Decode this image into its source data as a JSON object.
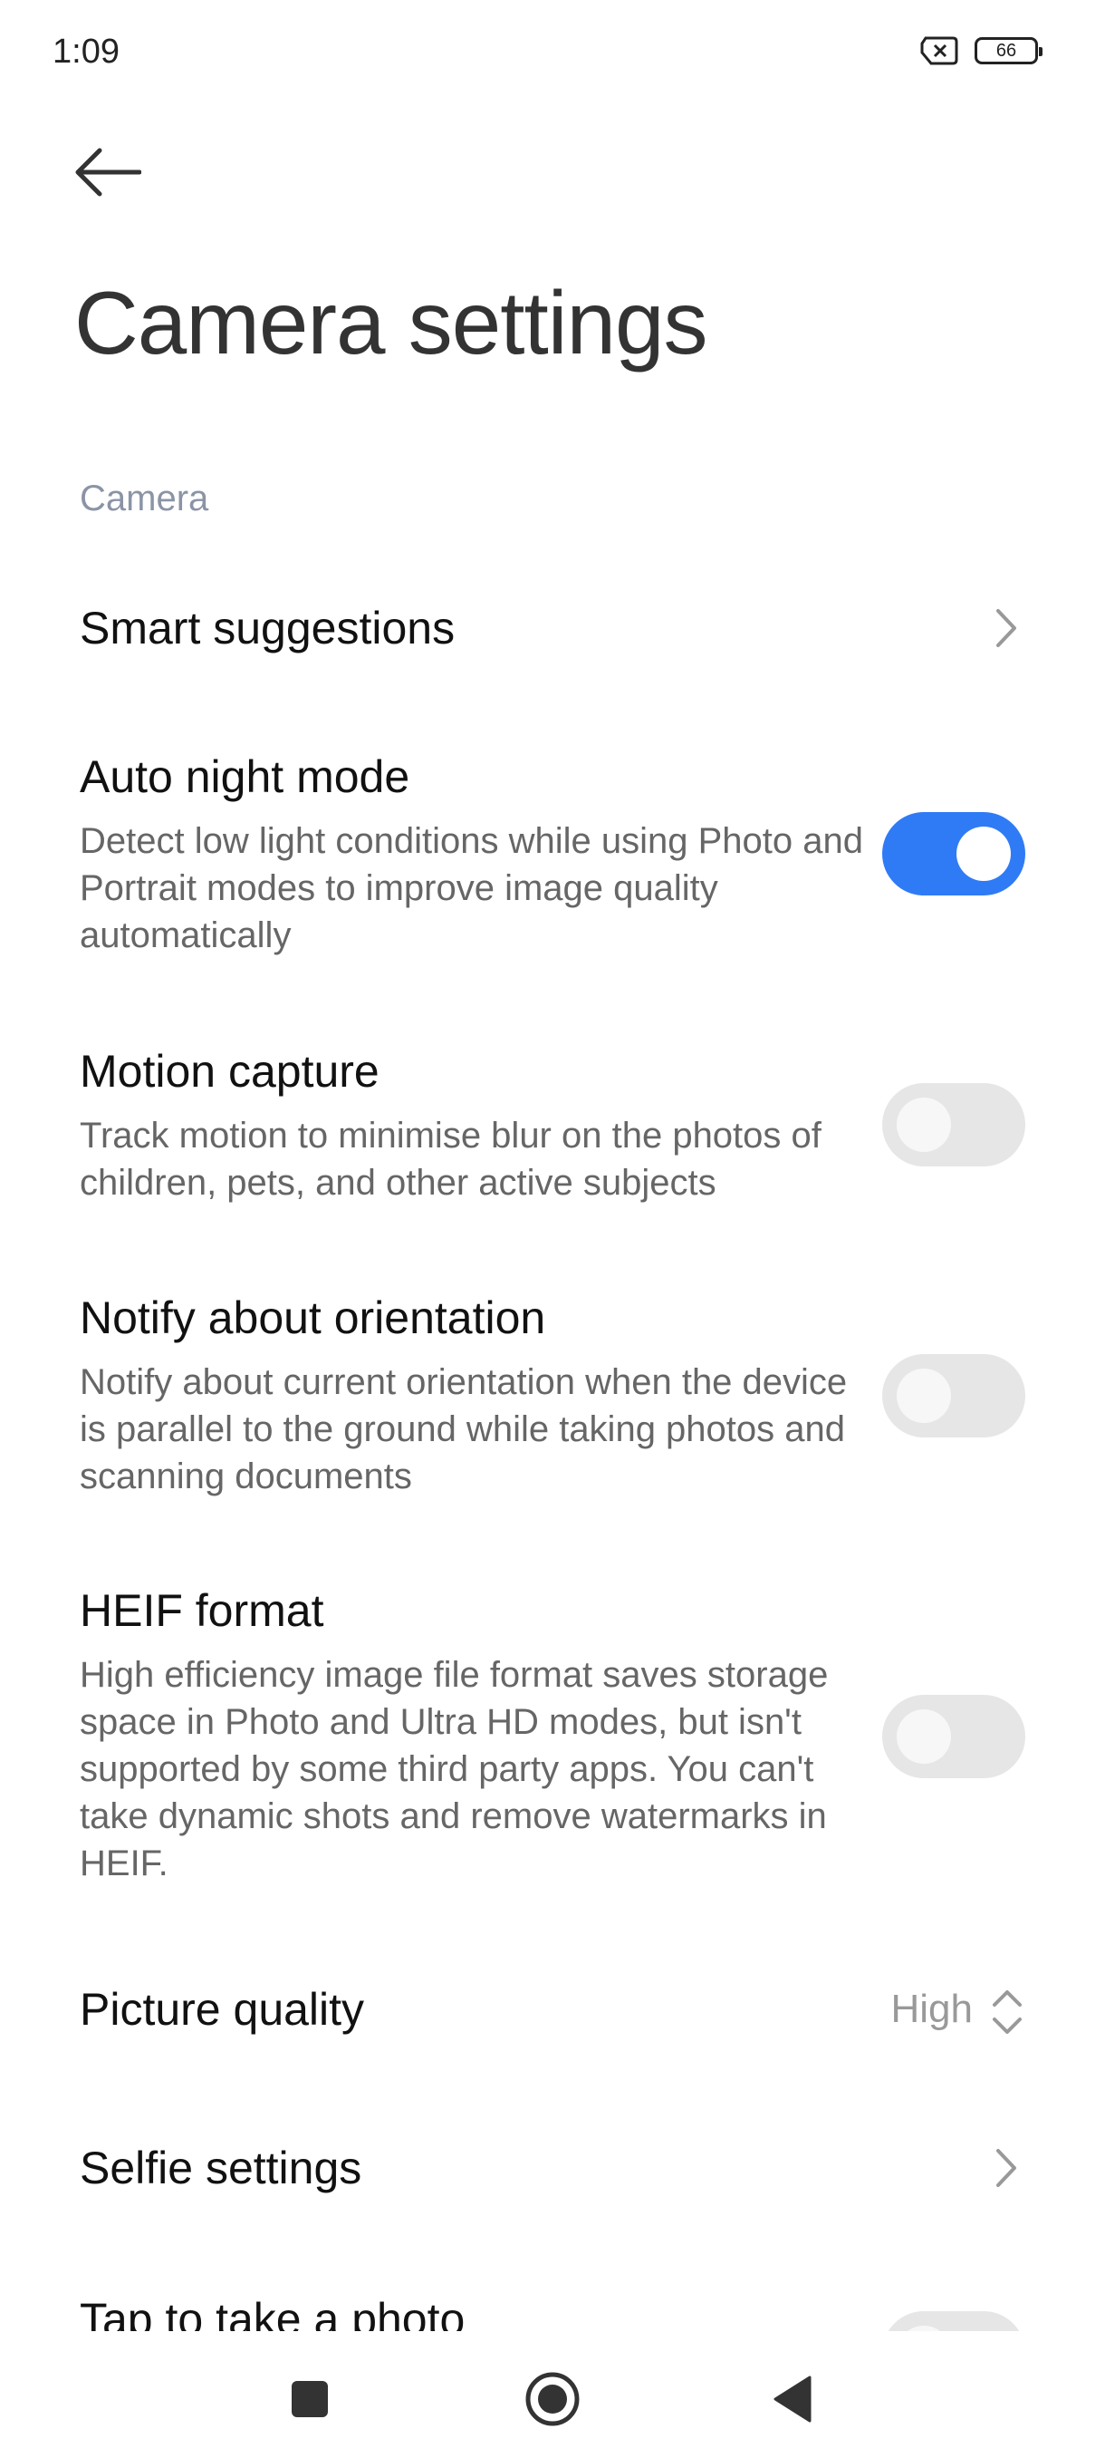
{
  "status": {
    "time": "1:09",
    "battery": "66"
  },
  "header": {
    "title": "Camera settings"
  },
  "section": {
    "label": "Camera"
  },
  "items": {
    "smart_suggestions": {
      "title": "Smart suggestions"
    },
    "auto_night": {
      "title": "Auto night mode",
      "desc": "Detect low light conditions while using Photo and Portrait modes to improve image quality automatically",
      "enabled": true
    },
    "motion_capture": {
      "title": "Motion capture",
      "desc": "Track motion to minimise blur on the photos of children, pets, and other active subjects",
      "enabled": false
    },
    "notify_orientation": {
      "title": "Notify about orientation",
      "desc": "Notify about current orientation when the device is parallel to the ground while taking photos and scanning documents",
      "enabled": false
    },
    "heif": {
      "title": "HEIF format",
      "desc": "High efficiency image file format saves storage space in Photo and Ultra HD modes, but isn't supported by some third party apps. You can't take dynamic shots and remove watermarks in HEIF.",
      "enabled": false
    },
    "picture_quality": {
      "title": "Picture quality",
      "value": "High"
    },
    "selfie": {
      "title": "Selfie settings"
    },
    "tap_photo": {
      "title": "Tap to take a photo",
      "enabled": false
    }
  },
  "colors": {
    "accent": "#2f7bf5",
    "toggle_off": "#e6e6e6",
    "secondary_text": "#666666",
    "section_label": "#8b94a6"
  }
}
